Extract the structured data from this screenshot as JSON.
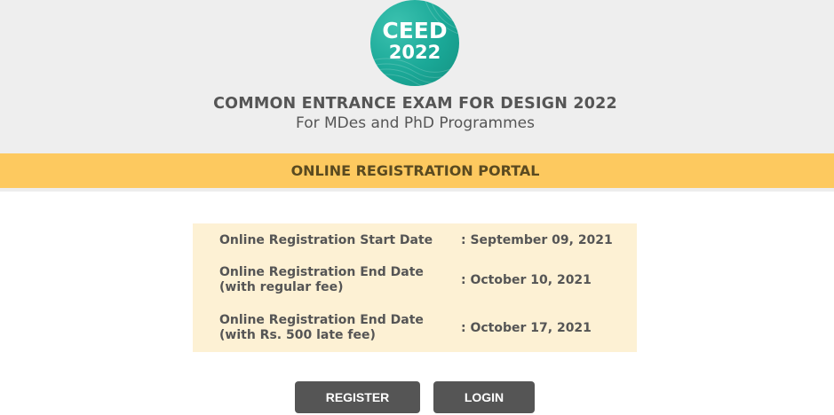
{
  "header": {
    "logo": {
      "line1": "CEED",
      "line2": "2022",
      "color": "#1aa897"
    },
    "title": "COMMON ENTRANCE EXAM FOR DESIGN 2022",
    "subtitle": "For MDes and PhD Programmes",
    "background": "#eeeeee"
  },
  "banner": {
    "text": "ONLINE REGISTRATION PORTAL",
    "color": "#fdc95f"
  },
  "dates": {
    "background": "#fdf1d4",
    "rows": [
      {
        "label_line1": "Online Registration Start Date",
        "label_line2": "",
        "value": ": September 09, 2021"
      },
      {
        "label_line1": "Online Registration End Date",
        "label_line2": "(with regular fee)",
        "value": ": October 10, 2021"
      },
      {
        "label_line1": "Online Registration End Date",
        "label_line2": "(with Rs. 500 late fee)",
        "value": ": October 17, 2021"
      }
    ]
  },
  "actions": {
    "register_label": "REGISTER",
    "login_label": "LOGIN",
    "button_color": "#555555"
  }
}
